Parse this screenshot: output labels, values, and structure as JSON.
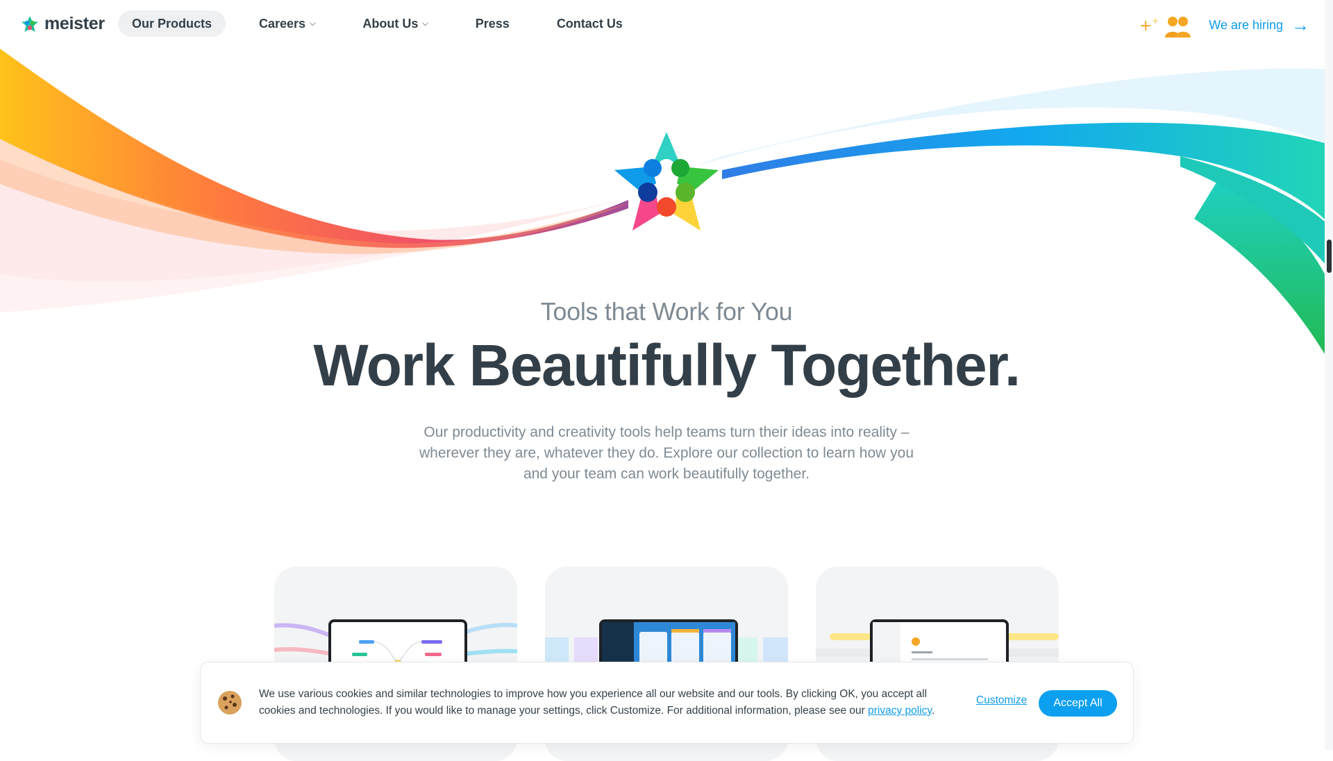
{
  "brand": {
    "name": "meister"
  },
  "nav": {
    "items": [
      {
        "label": "Our Products",
        "active": true
      },
      {
        "label": "Careers",
        "dropdown": true
      },
      {
        "label": "About Us",
        "dropdown": true
      },
      {
        "label": "Press"
      },
      {
        "label": "Contact Us"
      }
    ]
  },
  "hiring": {
    "label": "We are hiring"
  },
  "hero": {
    "eyebrow": "Tools that Work for You",
    "headline": "Work Beautifully Together.",
    "lead": "Our productivity and creativity tools help teams turn their ideas into reality – wherever they are, whatever they do. Explore our collection to learn how you and your team can work beautifully together."
  },
  "cookie": {
    "text": "We use various cookies and similar technologies to improve how you experience all our website and our tools. By clicking OK, you accept all cookies and technologies. If you would like to manage your settings, click Customize. For additional information, please see our",
    "link_text": "privacy policy",
    "customize_label": "Customize",
    "accept_label": "Accept All"
  },
  "colors": {
    "accent": "#0e9bea",
    "headline": "#333f48",
    "muted": "#7e8a93"
  },
  "icons": [
    "meister-logo-icon",
    "chevron-down-icon",
    "people-icon",
    "arrow-right-icon",
    "cookie-icon",
    "meister-star-icon"
  ]
}
